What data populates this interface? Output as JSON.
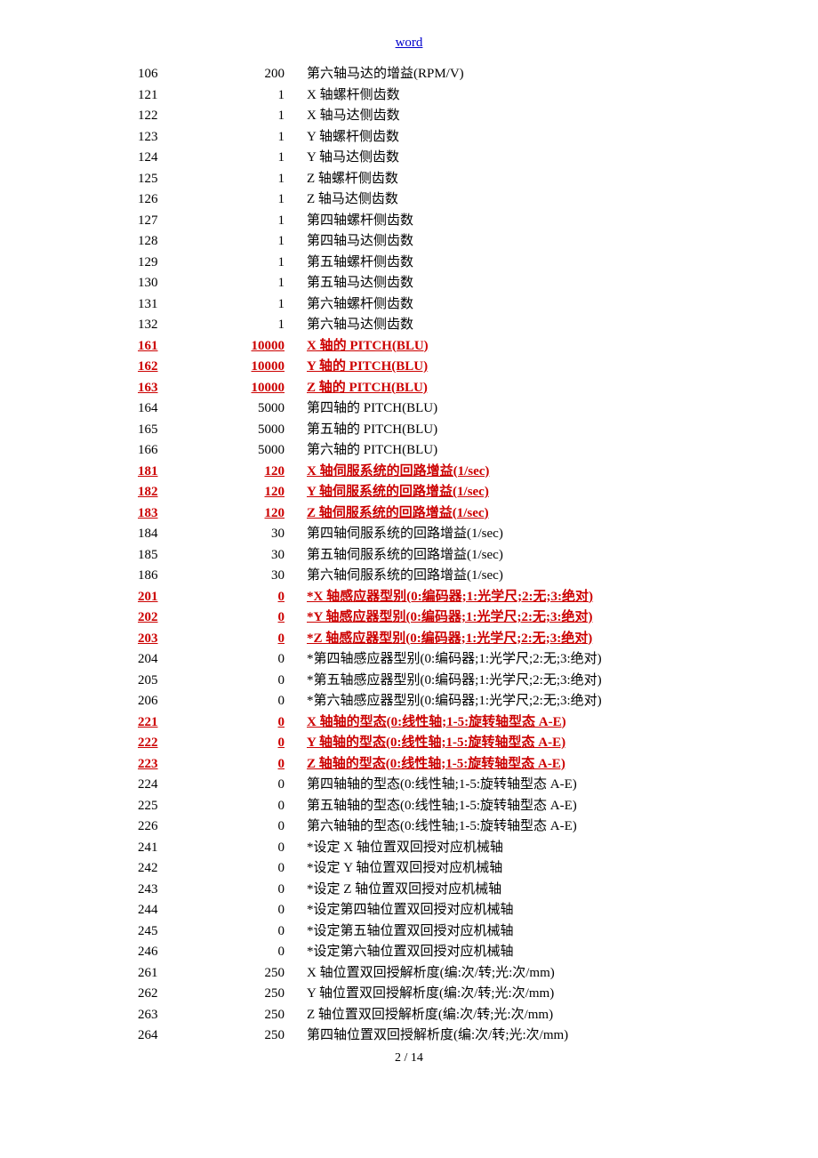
{
  "header_link": "word",
  "footer": "2  / 14",
  "rows": [
    {
      "id": "106",
      "val": "200",
      "desc": "第六轴马达的增益(RPM/V)",
      "hl": false
    },
    {
      "id": "121",
      "val": "1",
      "desc": "X 轴螺杆侧齿数",
      "hl": false
    },
    {
      "id": "122",
      "val": "1",
      "desc": "X 轴马达侧齿数",
      "hl": false
    },
    {
      "id": "123",
      "val": "1",
      "desc": "Y 轴螺杆侧齿数",
      "hl": false
    },
    {
      "id": "124",
      "val": "1",
      "desc": "Y 轴马达侧齿数",
      "hl": false
    },
    {
      "id": "125",
      "val": "1",
      "desc": "Z 轴螺杆侧齿数",
      "hl": false
    },
    {
      "id": "126",
      "val": "1",
      "desc": "Z 轴马达侧齿数",
      "hl": false
    },
    {
      "id": "127",
      "val": "1",
      "desc": "第四轴螺杆侧齿数",
      "hl": false
    },
    {
      "id": "128",
      "val": "1",
      "desc": "第四轴马达侧齿数",
      "hl": false
    },
    {
      "id": "129",
      "val": "1",
      "desc": "第五轴螺杆侧齿数",
      "hl": false
    },
    {
      "id": "130",
      "val": "1",
      "desc": "第五轴马达侧齿数",
      "hl": false
    },
    {
      "id": "131",
      "val": "1",
      "desc": "第六轴螺杆侧齿数",
      "hl": false
    },
    {
      "id": "132",
      "val": "1",
      "desc": "第六轴马达侧齿数",
      "hl": false
    },
    {
      "id": "161",
      "val": "10000",
      "desc": "X 轴的 PITCH(BLU)",
      "hl": true
    },
    {
      "id": "162",
      "val": "10000",
      "desc": "Y 轴的 PITCH(BLU)",
      "hl": true
    },
    {
      "id": "163",
      "val": "10000",
      "desc": "Z 轴的 PITCH(BLU)",
      "hl": true
    },
    {
      "id": "164",
      "val": "5000",
      "desc": "第四轴的 PITCH(BLU)",
      "hl": false
    },
    {
      "id": "165",
      "val": "5000",
      "desc": "第五轴的 PITCH(BLU)",
      "hl": false
    },
    {
      "id": "166",
      "val": "5000",
      "desc": "第六轴的 PITCH(BLU)",
      "hl": false
    },
    {
      "id": "181",
      "val": "120",
      "desc": "X 轴伺服系统的回路增益(1/sec)",
      "hl": true
    },
    {
      "id": "182",
      "val": "120",
      "desc": "Y 轴伺服系统的回路增益(1/sec)",
      "hl": true
    },
    {
      "id": "183",
      "val": "120",
      "desc": "Z 轴伺服系统的回路增益(1/sec)",
      "hl": true
    },
    {
      "id": "184",
      "val": "30",
      "desc": "第四轴伺服系统的回路增益(1/sec)",
      "hl": false
    },
    {
      "id": "185",
      "val": "30",
      "desc": "第五轴伺服系统的回路增益(1/sec)",
      "hl": false
    },
    {
      "id": "186",
      "val": "30",
      "desc": "第六轴伺服系统的回路增益(1/sec)",
      "hl": false
    },
    {
      "id": "201",
      "val": "0",
      "desc": "*X 轴感应器型别(0:编码器;1:光学尺;2:无;3:绝对)",
      "hl": true
    },
    {
      "id": "202",
      "val": "0",
      "desc": "*Y 轴感应器型别(0:编码器;1:光学尺;2:无;3:绝对)",
      "hl": true
    },
    {
      "id": "203",
      "val": "0",
      "desc": "*Z 轴感应器型别(0:编码器;1:光学尺;2:无;3:绝对)",
      "hl": true
    },
    {
      "id": "204",
      "val": "0",
      "desc": "*第四轴感应器型别(0:编码器;1:光学尺;2:无;3:绝对)",
      "hl": false
    },
    {
      "id": "205",
      "val": "0",
      "desc": "*第五轴感应器型别(0:编码器;1:光学尺;2:无;3:绝对)",
      "hl": false
    },
    {
      "id": "206",
      "val": "0",
      "desc": "*第六轴感应器型别(0:编码器;1:光学尺;2:无;3:绝对)",
      "hl": false
    },
    {
      "id": "221",
      "val": "0",
      "desc": "X 轴轴的型态(0:线性轴;1-5:旋转轴型态 A-E)",
      "hl": true
    },
    {
      "id": "222",
      "val": "0",
      "desc": "Y 轴轴的型态(0:线性轴;1-5:旋转轴型态 A-E)",
      "hl": true
    },
    {
      "id": "223",
      "val": "0",
      "desc": "Z 轴轴的型态(0:线性轴;1-5:旋转轴型态 A-E)",
      "hl": true
    },
    {
      "id": "224",
      "val": "0",
      "desc": "第四轴轴的型态(0:线性轴;1-5:旋转轴型态 A-E)",
      "hl": false
    },
    {
      "id": "225",
      "val": "0",
      "desc": "第五轴轴的型态(0:线性轴;1-5:旋转轴型态 A-E)",
      "hl": false
    },
    {
      "id": "226",
      "val": "0",
      "desc": "第六轴轴的型态(0:线性轴;1-5:旋转轴型态 A-E)",
      "hl": false
    },
    {
      "id": "241",
      "val": "0",
      "desc": "*设定 X 轴位置双回授对应机械轴",
      "hl": false
    },
    {
      "id": "242",
      "val": "0",
      "desc": "*设定 Y 轴位置双回授对应机械轴",
      "hl": false
    },
    {
      "id": "243",
      "val": "0",
      "desc": "*设定 Z 轴位置双回授对应机械轴",
      "hl": false
    },
    {
      "id": "244",
      "val": "0",
      "desc": "*设定第四轴位置双回授对应机械轴",
      "hl": false
    },
    {
      "id": "245",
      "val": "0",
      "desc": "*设定第五轴位置双回授对应机械轴",
      "hl": false
    },
    {
      "id": "246",
      "val": "0",
      "desc": "*设定第六轴位置双回授对应机械轴",
      "hl": false
    },
    {
      "id": "261",
      "val": "250",
      "desc": "X 轴位置双回授解析度(编:次/转;光:次/mm)",
      "hl": false
    },
    {
      "id": "262",
      "val": "250",
      "desc": "Y 轴位置双回授解析度(编:次/转;光:次/mm)",
      "hl": false
    },
    {
      "id": "263",
      "val": "250",
      "desc": "Z 轴位置双回授解析度(编:次/转;光:次/mm)",
      "hl": false
    },
    {
      "id": "264",
      "val": "250",
      "desc": "第四轴位置双回授解析度(编:次/转;光:次/mm)",
      "hl": false
    }
  ]
}
